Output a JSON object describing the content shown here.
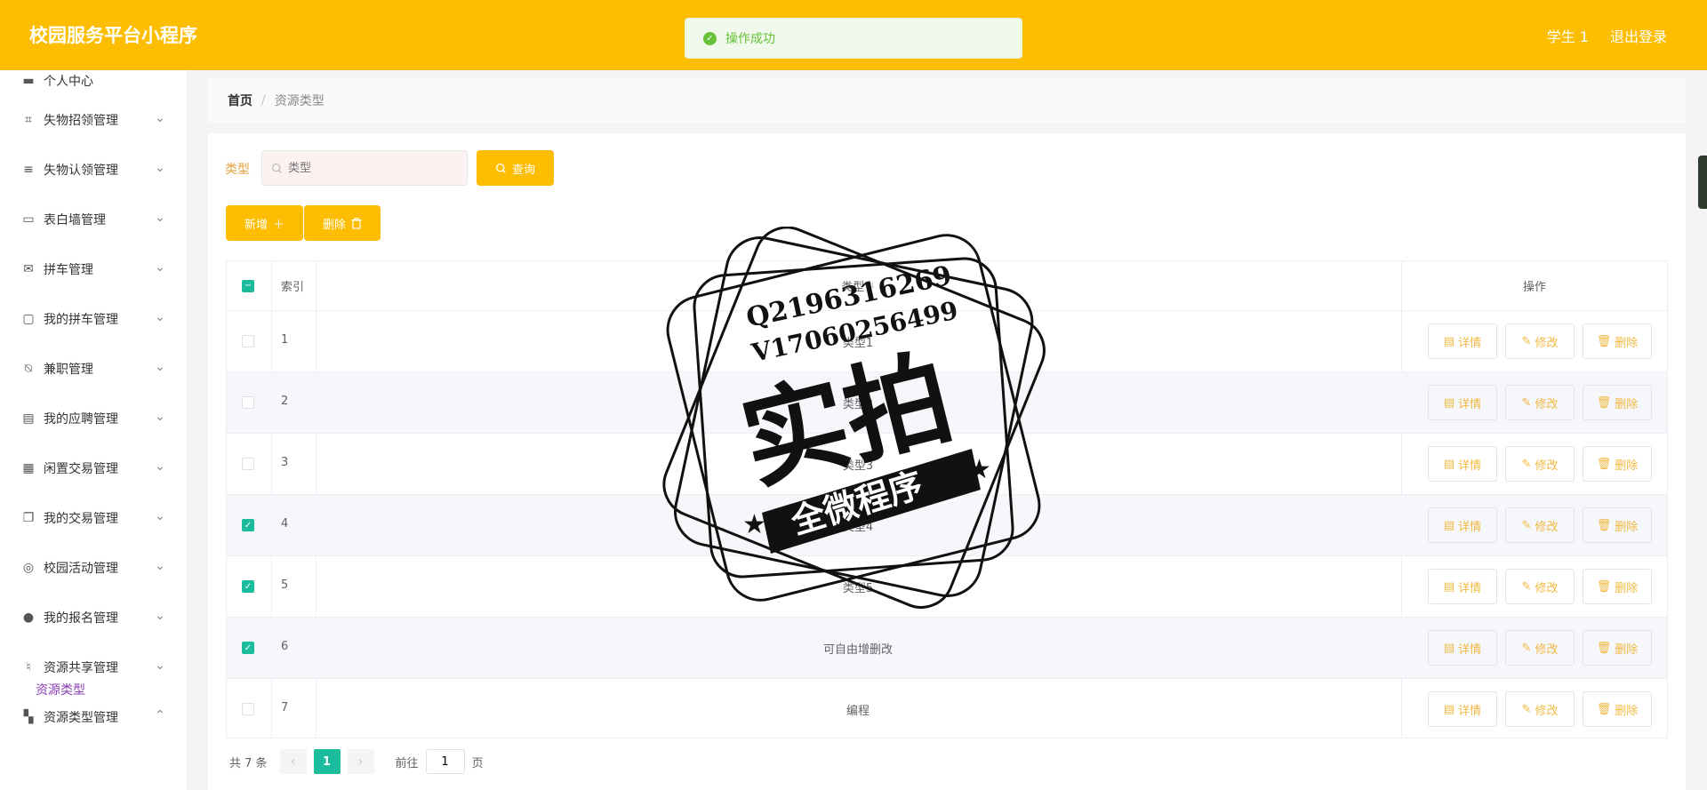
{
  "header": {
    "title": "校园服务平台小程序",
    "user": "学生 1",
    "logout": "退出登录"
  },
  "toast": {
    "message": "操作成功"
  },
  "sidebar": {
    "top_partial": "个人中心",
    "items": [
      {
        "label": "失物招领管理",
        "icon": "crop-icon"
      },
      {
        "label": "失物认领管理",
        "icon": "menu-icon"
      },
      {
        "label": "表白墙管理",
        "icon": "monitor-icon"
      },
      {
        "label": "拼车管理",
        "icon": "mail-icon"
      },
      {
        "label": "我的拼车管理",
        "icon": "chat-icon"
      },
      {
        "label": "兼职管理",
        "icon": "bell-off-icon"
      },
      {
        "label": "我的应聘管理",
        "icon": "clipboard-icon"
      },
      {
        "label": "闲置交易管理",
        "icon": "grid-icon"
      },
      {
        "label": "我的交易管理",
        "icon": "copy-icon"
      },
      {
        "label": "校园活动管理",
        "icon": "compass-icon"
      },
      {
        "label": "我的报名管理",
        "icon": "user-icon"
      },
      {
        "label": "资源共享管理",
        "icon": "mic-icon"
      },
      {
        "label": "资源类型管理",
        "icon": "apps-icon"
      }
    ],
    "sub_item": "资源类型"
  },
  "breadcrumb": {
    "home": "首页",
    "sep": "/",
    "current": "资源类型"
  },
  "search": {
    "label": "类型",
    "placeholder": "类型",
    "button": "查询"
  },
  "actions": {
    "add": "新增",
    "delete": "删除"
  },
  "table": {
    "headers": {
      "index": "索引",
      "type": "类型",
      "ops": "操作"
    },
    "rows": [
      {
        "index": "1",
        "type": "类型1",
        "checked": false
      },
      {
        "index": "2",
        "type": "类型2",
        "checked": false
      },
      {
        "index": "3",
        "type": "类型3",
        "checked": false
      },
      {
        "index": "4",
        "type": "类型4",
        "checked": true
      },
      {
        "index": "5",
        "type": "类型5",
        "checked": true
      },
      {
        "index": "6",
        "type": "可自由增删改",
        "checked": true
      },
      {
        "index": "7",
        "type": "编程",
        "checked": false
      }
    ],
    "op_labels": {
      "detail": "详情",
      "edit": "修改",
      "delete": "删除"
    }
  },
  "pagination": {
    "total": "共 7 条",
    "current_page": "1",
    "goto_prefix": "前往",
    "goto_value": "1",
    "goto_suffix": "页"
  },
  "watermark": {
    "line1": "Q2196316269",
    "line2": "V17060256499",
    "main": "实拍",
    "banner": "全微程序"
  },
  "colors": {
    "accent": "#fdbd01",
    "teal": "#1abc9c",
    "success": "#67c23a"
  }
}
